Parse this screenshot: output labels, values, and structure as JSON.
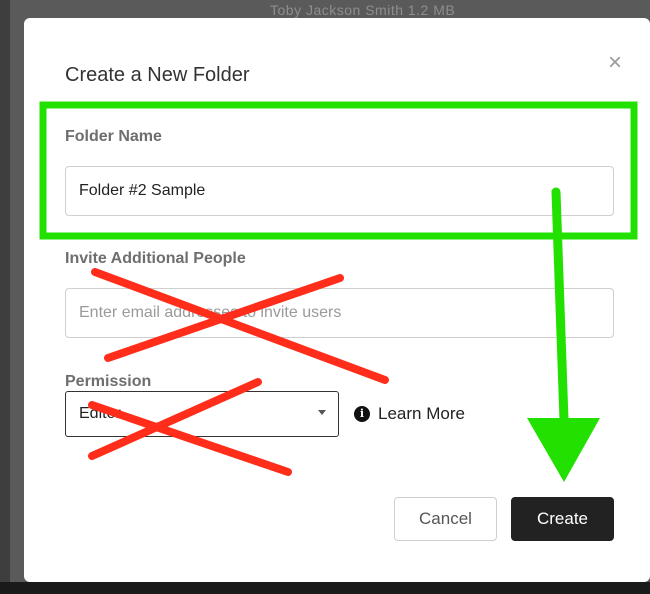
{
  "background": {
    "ghost_text": "Toby Jackson  Smith         1.2 MB"
  },
  "dialog": {
    "title": "Create a New Folder",
    "close_label": "×",
    "folder_name": {
      "label": "Folder Name",
      "value": "Folder #2 Sample"
    },
    "invite": {
      "label": "Invite Additional People",
      "placeholder": "Enter email addresses to invite users"
    },
    "permission": {
      "label": "Permission",
      "selected": "Editor"
    },
    "learn_more": {
      "icon": "info-icon",
      "icon_glyph": "i",
      "label": "Learn More"
    },
    "buttons": {
      "cancel": "Cancel",
      "create": "Create"
    }
  },
  "annotations": {
    "highlight_color": "#22e000",
    "cross_color": "#ff2d1a",
    "arrow_color": "#22e000"
  }
}
